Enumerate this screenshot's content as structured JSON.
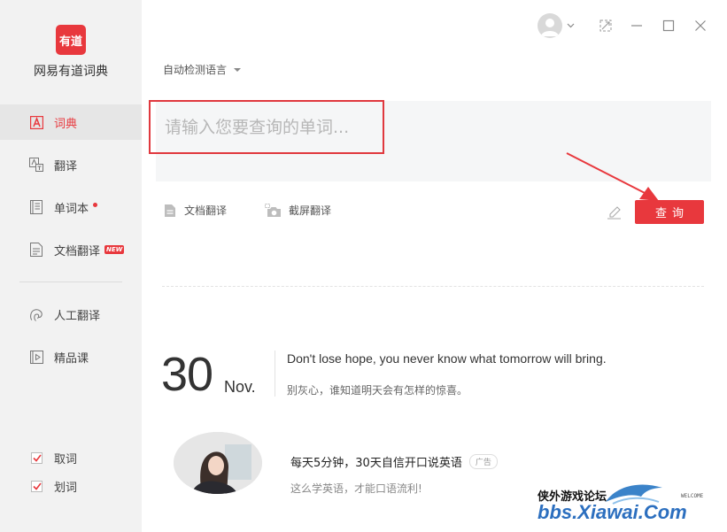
{
  "app": {
    "name": "网易有道词典",
    "logo_text": "有道"
  },
  "sidebar": {
    "items": [
      {
        "label": "词典",
        "icon": "dictionary-icon",
        "active": true
      },
      {
        "label": "翻译",
        "icon": "translate-icon"
      },
      {
        "label": "单词本",
        "icon": "wordbook-icon",
        "dot": true
      },
      {
        "label": "文档翻译",
        "icon": "document-icon",
        "badge": "NEW"
      },
      {
        "label": "人工翻译",
        "icon": "human-translate-icon"
      },
      {
        "label": "精品课",
        "icon": "course-icon"
      }
    ],
    "checks": [
      {
        "label": "取词",
        "checked": true
      },
      {
        "label": "划词",
        "checked": true
      }
    ]
  },
  "main": {
    "language_select": "自动检测语言",
    "query_placeholder": "请输入您要查询的单词...",
    "doc_translate": "文档翻译",
    "screenshot_translate": "截屏翻译",
    "search_button": "查询"
  },
  "daily": {
    "day": "30",
    "month": "Nov.",
    "quote_en": "Don't lose hope, you never know what tomorrow will bring.",
    "quote_cn": "别灰心，谁知道明天会有怎样的惊喜。"
  },
  "ad": {
    "title": "每天5分钟，30天自信开口说英语",
    "badge": "广告",
    "subtitle": "这么学英语，才能口语流利!"
  },
  "watermark": {
    "cn": "侠外游戏论坛",
    "welcome": "WELCOME",
    "url": "bbs.Xiawai.Com"
  },
  "colors": {
    "accent": "#e8383d",
    "sidebar_bg": "#f2f2f2",
    "query_bg": "#f5f6f7"
  }
}
